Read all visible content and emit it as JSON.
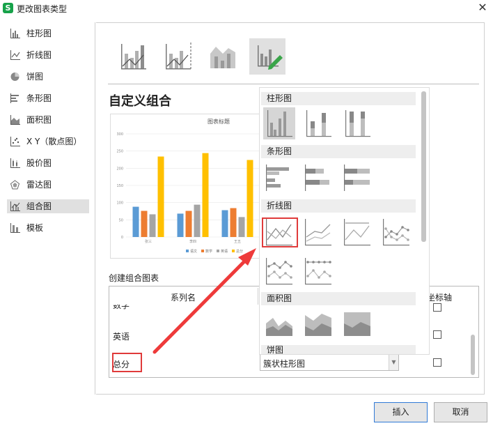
{
  "window": {
    "title": "更改图表类型",
    "logo_text": "S",
    "close_symbol": "✕"
  },
  "sidebar": {
    "items": [
      {
        "label": "柱形图",
        "icon": "column-chart-icon"
      },
      {
        "label": "折线图",
        "icon": "line-chart-icon"
      },
      {
        "label": "饼图",
        "icon": "pie-chart-icon"
      },
      {
        "label": "条形图",
        "icon": "bar-chart-icon"
      },
      {
        "label": "面积图",
        "icon": "area-chart-icon"
      },
      {
        "label": "X Y（散点图）",
        "icon": "scatter-chart-icon"
      },
      {
        "label": "股价图",
        "icon": "stock-chart-icon"
      },
      {
        "label": "雷达图",
        "icon": "radar-chart-icon"
      },
      {
        "label": "组合图",
        "icon": "combo-chart-icon"
      },
      {
        "label": "模板",
        "icon": "template-icon"
      }
    ],
    "selected_index": 8
  },
  "main": {
    "section_title": "自定义组合",
    "create_label": "创建组合图表",
    "preview_chart": {
      "title": "图表标题",
      "y_ticks": [
        "300",
        "250",
        "200",
        "150",
        "100",
        "50",
        "0"
      ],
      "categories": [
        "张三",
        "李四",
        "王五"
      ],
      "legend": [
        "语文",
        "数学",
        "英语",
        "总分"
      ]
    },
    "table": {
      "col_name_header": "系列名",
      "col_axis_header": "坐标轴",
      "rows": [
        {
          "name": "数学"
        },
        {
          "name": "英语"
        },
        {
          "name": "总分",
          "chart_type": "簇状柱形图"
        }
      ]
    }
  },
  "popup": {
    "groups": [
      "柱形图",
      "条形图",
      "折线图",
      "面积图",
      "饼图"
    ]
  },
  "buttons": {
    "insert": "插入",
    "cancel": "取消"
  },
  "colors": {
    "series_blue": "#5b9bd5",
    "series_orange": "#ed7d31",
    "series_gray": "#a5a5a5",
    "series_gold": "#ffc000",
    "highlight_red": "#e03a3a",
    "arrow_red": "#ee3a3a",
    "selected_bg": "#e0e0e0",
    "primary_border": "#2f79d6"
  },
  "chart_data": {
    "type": "bar",
    "title": "图表标题",
    "categories": [
      "张三",
      "李四",
      "王五"
    ],
    "series": [
      {
        "name": "语文",
        "values": [
          88,
          68,
          78
        ]
      },
      {
        "name": "数学",
        "values": [
          76,
          76,
          84
        ]
      },
      {
        "name": "英语",
        "values": [
          66,
          94,
          58
        ]
      },
      {
        "name": "总分",
        "values": [
          234,
          244,
          224
        ]
      }
    ],
    "ylim": [
      0,
      300
    ],
    "xlabel": "",
    "ylabel": "",
    "legend_position": "bottom",
    "grid": true
  }
}
